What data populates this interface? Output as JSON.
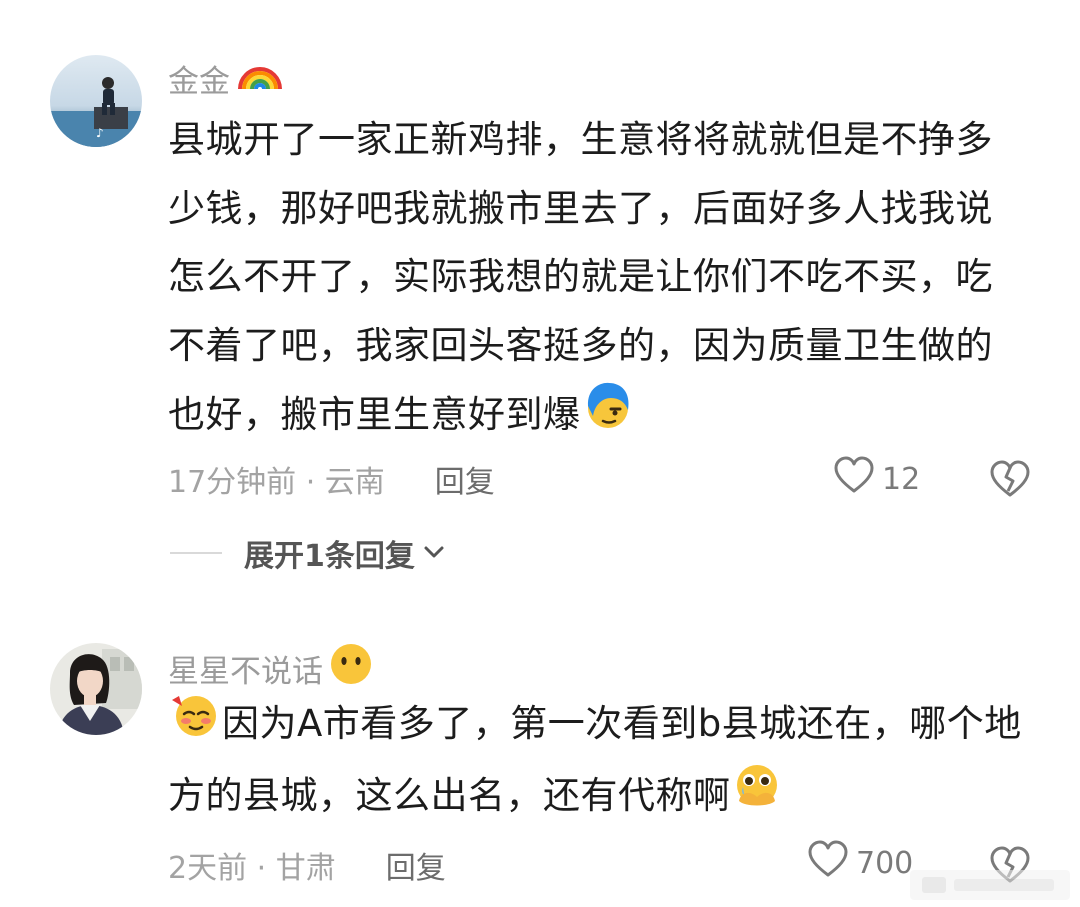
{
  "comments": [
    {
      "username": "金金",
      "username_emoji_icon": "rainbow-icon",
      "text": "县城开了一家正新鸡排，生意将将就就但是不挣多少钱，那好吧我就搬市里去了，后面好多人找我说怎么不开了，实际我想的就是让你们不吃不买，吃不着了吧，我家回头客挺多的，因为质量卫生做的也好，搬市里生意好到爆",
      "text_end_emoji_icon": "smug-blue-hair-emoji-icon",
      "time_location": "17分钟前 · 云南",
      "reply_label": "回复",
      "like_count": "12",
      "expand_label": "展开1条回复"
    },
    {
      "username": "星星不说话",
      "username_emoji_icon": "silent-face-emoji-icon",
      "text_start_emoji_icon": "tipsy-face-emoji-icon",
      "text": "因为A市看多了，第一次看到b县城还在，哪个地方的县城，这么出名，还有代称啊",
      "text_end_emoji_icon": "teary-hands-emoji-icon",
      "time_location": "2天前 · 甘肃",
      "reply_label": "回复",
      "like_count": "700"
    }
  ],
  "colors": {
    "username": "#9b9b9b",
    "body_text": "#1c1c1c",
    "meta": "#a3a3a3",
    "reply": "#6c6c6c",
    "expand": "#555555"
  }
}
